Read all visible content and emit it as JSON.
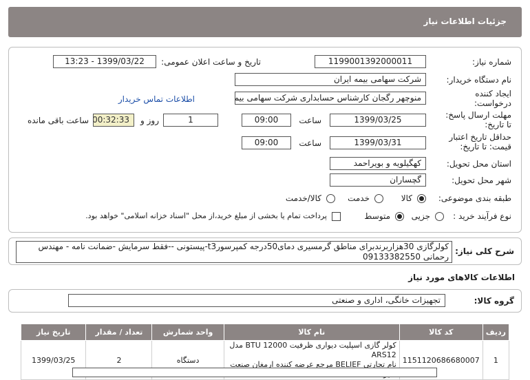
{
  "header": {
    "title": "جزئیات اطلاعات نیاز"
  },
  "fields": {
    "need_number_label": "شماره نیاز:",
    "need_number": "1199001392000011",
    "announce_label": "تاریخ و ساعت اعلان عمومی:",
    "announce_value": "1399/03/22 - 13:23",
    "buyer_label": "نام دستگاه خریدار:",
    "buyer_value": "شرکت سهامی بیمه ایران",
    "creator_label_line1": "ایجاد کننده",
    "creator_label_line2": "درخواست:",
    "creator_value": "منوچهر رگجان کارشناس حسابداری شرکت سهامی بیمه ایران",
    "contact_link": "اطلاعات تماس خریدار",
    "deadline_label_line1": "مهلت ارسال پاسخ:",
    "deadline_label_line2": "تا تاریخ:",
    "deadline_date": "1399/03/25",
    "time_label": "ساعت",
    "deadline_time": "09:00",
    "days_value": "1",
    "days_label": "روز و",
    "remaining_timer": "00:32:33",
    "remaining_label": "ساعت باقی مانده",
    "validity_label_line1": "حداقل تاریخ اعتبار",
    "validity_label_line2": "قیمت: تا تاریخ:",
    "validity_date": "1399/03/31",
    "validity_time": "09:00",
    "province_label": "استان محل تحویل:",
    "province_value": "کهگیلویه و بویراحمد",
    "city_label": "شهر محل تحویل:",
    "city_value": "گچساران",
    "category_label": "طبقه بندی موضوعی:",
    "category_options": [
      "کالا",
      "خدمت",
      "کالا/خدمت"
    ],
    "process_label": "نوع فرآیند خرید :",
    "process_options": [
      "جزیی",
      "متوسط"
    ],
    "payment_note": "پرداخت تمام یا بخشی از مبلغ خرید،از محل \"اسناد خزانه اسلامی\" خواهد بود."
  },
  "description": {
    "label": "شرح کلی نیاز:",
    "text": "کولرگازی 30هزاربرندبرای مناطق گرمسیری دمای50درجه کمپرسورt3-پیستونی --فقط سرمایش -ضمانت نامه - مهندس رحمانی 09133382550"
  },
  "goods_section_title": "اطلاعات کالاهای مورد نیاز",
  "goods_group": {
    "label": "گروه کالا:",
    "value": "تجهیزات خانگی، اداری و صنعتی"
  },
  "table": {
    "headers": [
      "ردیف",
      "کد کالا",
      "نام کالا",
      "واحد شمارش",
      "تعداد / مقدار",
      "تاریخ نیاز"
    ],
    "rows": [
      {
        "row": "1",
        "code": "1151120686680007",
        "name_line1": "کولر گازی اسپلیت دیواری ظرفیت BTU 12000 مدل ARS12",
        "name_line2": "نام تجارتی BELIEF مرجع عرضه کننده ارمغان صنعت سیراف",
        "unit": "دستگاه",
        "qty": "2",
        "date": "1399/03/25"
      }
    ]
  }
}
